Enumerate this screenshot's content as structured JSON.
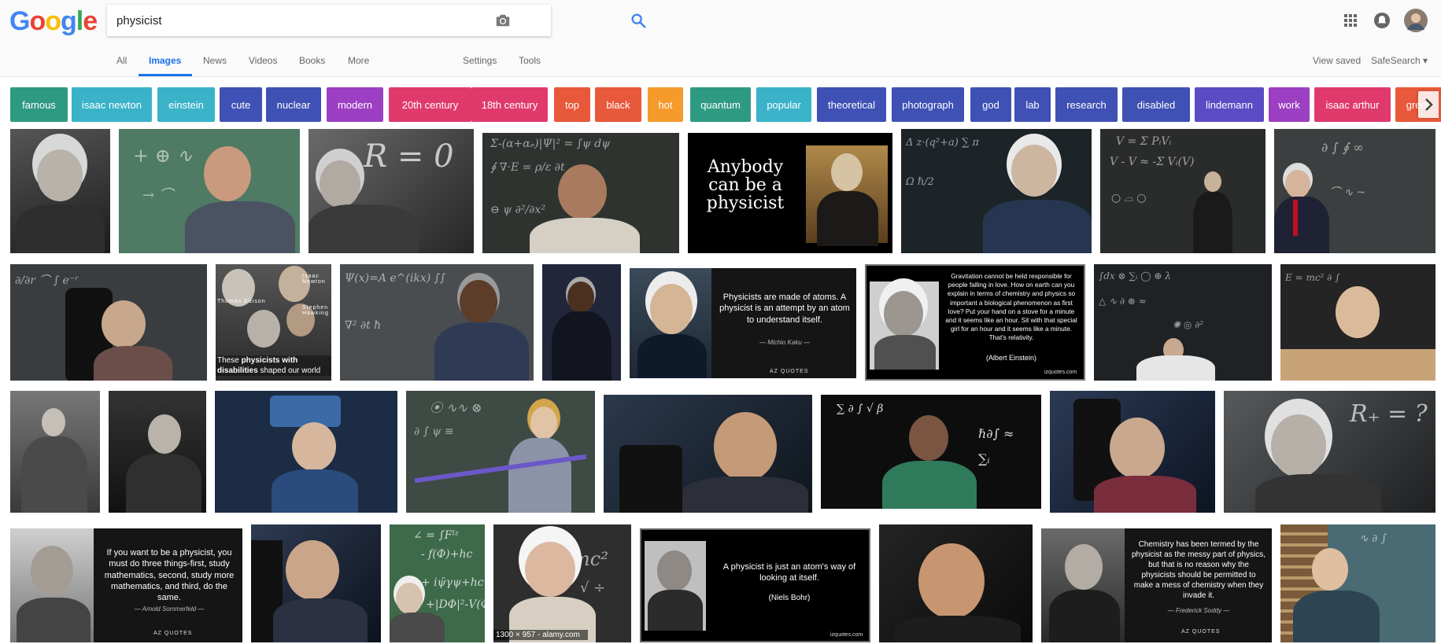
{
  "logo": {
    "letters": [
      "G",
      "o",
      "o",
      "g",
      "l",
      "e"
    ],
    "colors": [
      "#4285F4",
      "#EA4335",
      "#FBBC05",
      "#4285F4",
      "#34A853",
      "#EA4335"
    ]
  },
  "search": {
    "query": "physicist",
    "placeholder": ""
  },
  "header_icons": [
    "apps-grid-icon",
    "notifications-icon",
    "account-avatar"
  ],
  "nav": {
    "tabs": [
      "All",
      "Images",
      "News",
      "Videos",
      "Books",
      "More"
    ],
    "active": "Images",
    "settings": "Settings",
    "tools": "Tools",
    "view_saved": "View saved",
    "safesearch": "SafeSearch ▾"
  },
  "chips": [
    {
      "label": "famous",
      "color": "#2f9a82"
    },
    {
      "label": "isaac newton",
      "color": "#3ab3c9"
    },
    {
      "label": "einstein",
      "color": "#3ab3c9"
    },
    {
      "label": "cute",
      "color": "#3f51b5"
    },
    {
      "label": "nuclear",
      "color": "#3f51b5"
    },
    {
      "label": "modern",
      "color": "#9c3fc2"
    },
    {
      "label": "20th century",
      "color": "#e03a6d"
    },
    {
      "label": "18th century",
      "color": "#e03a6d"
    },
    {
      "label": "top",
      "color": "#e8583a"
    },
    {
      "label": "black",
      "color": "#e8583a"
    },
    {
      "label": "hot",
      "color": "#f59b2c"
    },
    {
      "label": "quantum",
      "color": "#2f9a82"
    },
    {
      "label": "popular",
      "color": "#3ab3c9"
    },
    {
      "label": "theoretical",
      "color": "#3f51b5"
    },
    {
      "label": "photograph",
      "color": "#3f51b5"
    },
    {
      "label": "god",
      "color": "#3f51b5"
    },
    {
      "label": "lab",
      "color": "#3f51b5"
    },
    {
      "label": "research",
      "color": "#3f51b5"
    },
    {
      "label": "disabled",
      "color": "#3f51b5"
    },
    {
      "label": "lindemann",
      "color": "#5b4bc4"
    },
    {
      "label": "work",
      "color": "#9c3fc2"
    },
    {
      "label": "isaac arthur",
      "color": "#e03a6d"
    },
    {
      "label": "greek",
      "color": "#e8583a"
    }
  ],
  "images": {
    "r1_4_poster": "Anybody can be a physicist",
    "r2_1_caption_pre": "These ",
    "r2_1_caption_bold": "physicists with disabilities",
    "r2_1_caption_post": " shaped our world",
    "r2_1_names": [
      "Thomas Edison",
      "Isaac Newton",
      "Stephen Hawking"
    ],
    "r2_4_quote": "Physicists are made of atoms. A physicist is an attempt by an atom to understand itself.",
    "r2_4_author": "— Michio Kaku —",
    "r2_4_brand": "AZ QUOTES",
    "r2_5_quote": "Gravitation cannot be held responsible for people falling in love. How on earth can you explain in terms of chemistry and physics so important a biological phenomenon as first love? Put your hand on a stove for a minute and it seems like an hour. Sit with that special girl for an hour and it seems like a minute. That's relativity.",
    "r2_5_author": "(Albert Einstein)",
    "r2_5_brand": "izquotes.com",
    "r4_1_quote": "If you want to be a physicist, you must do three things-first, study mathematics, second, study more mathematics, and third, do the same.",
    "r4_1_author": "— Arnold Sommerfeld —",
    "r4_1_brand": "AZ QUOTES",
    "r4_4_badge": "1300 × 957 - alamy.com",
    "r4_5_quote": "A physicist is just an atom's way of looking at itself.",
    "r4_5_author": "(Niels Bohr)",
    "r4_5_brand": "izquotes.com",
    "r4_7_quote": "Chemistry has been termed by the physicist as the messy part of physics, but that is no reason why the physicists should be permitted to make a mess of chemistry when they invade it.",
    "r4_7_author": "— Frederick Soddy —",
    "r4_7_brand": "AZ QUOTES"
  }
}
